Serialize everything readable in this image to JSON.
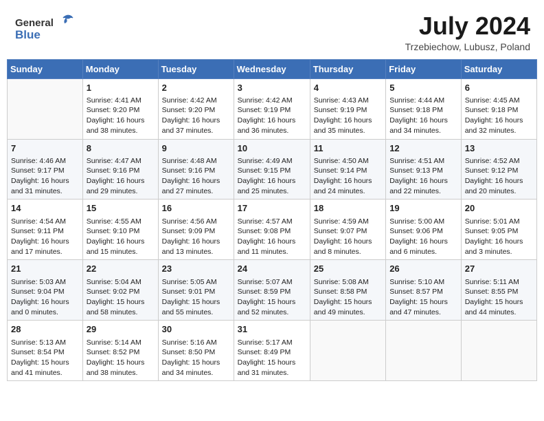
{
  "header": {
    "logo_general": "General",
    "logo_blue": "Blue",
    "month_year": "July 2024",
    "location": "Trzebiechow, Lubusz, Poland"
  },
  "weekdays": [
    "Sunday",
    "Monday",
    "Tuesday",
    "Wednesday",
    "Thursday",
    "Friday",
    "Saturday"
  ],
  "weeks": [
    [
      {
        "day": "",
        "sunrise": "",
        "sunset": "",
        "daylight": ""
      },
      {
        "day": "1",
        "sunrise": "Sunrise: 4:41 AM",
        "sunset": "Sunset: 9:20 PM",
        "daylight": "Daylight: 16 hours and 38 minutes."
      },
      {
        "day": "2",
        "sunrise": "Sunrise: 4:42 AM",
        "sunset": "Sunset: 9:20 PM",
        "daylight": "Daylight: 16 hours and 37 minutes."
      },
      {
        "day": "3",
        "sunrise": "Sunrise: 4:42 AM",
        "sunset": "Sunset: 9:19 PM",
        "daylight": "Daylight: 16 hours and 36 minutes."
      },
      {
        "day": "4",
        "sunrise": "Sunrise: 4:43 AM",
        "sunset": "Sunset: 9:19 PM",
        "daylight": "Daylight: 16 hours and 35 minutes."
      },
      {
        "day": "5",
        "sunrise": "Sunrise: 4:44 AM",
        "sunset": "Sunset: 9:18 PM",
        "daylight": "Daylight: 16 hours and 34 minutes."
      },
      {
        "day": "6",
        "sunrise": "Sunrise: 4:45 AM",
        "sunset": "Sunset: 9:18 PM",
        "daylight": "Daylight: 16 hours and 32 minutes."
      }
    ],
    [
      {
        "day": "7",
        "sunrise": "Sunrise: 4:46 AM",
        "sunset": "Sunset: 9:17 PM",
        "daylight": "Daylight: 16 hours and 31 minutes."
      },
      {
        "day": "8",
        "sunrise": "Sunrise: 4:47 AM",
        "sunset": "Sunset: 9:16 PM",
        "daylight": "Daylight: 16 hours and 29 minutes."
      },
      {
        "day": "9",
        "sunrise": "Sunrise: 4:48 AM",
        "sunset": "Sunset: 9:16 PM",
        "daylight": "Daylight: 16 hours and 27 minutes."
      },
      {
        "day": "10",
        "sunrise": "Sunrise: 4:49 AM",
        "sunset": "Sunset: 9:15 PM",
        "daylight": "Daylight: 16 hours and 25 minutes."
      },
      {
        "day": "11",
        "sunrise": "Sunrise: 4:50 AM",
        "sunset": "Sunset: 9:14 PM",
        "daylight": "Daylight: 16 hours and 24 minutes."
      },
      {
        "day": "12",
        "sunrise": "Sunrise: 4:51 AM",
        "sunset": "Sunset: 9:13 PM",
        "daylight": "Daylight: 16 hours and 22 minutes."
      },
      {
        "day": "13",
        "sunrise": "Sunrise: 4:52 AM",
        "sunset": "Sunset: 9:12 PM",
        "daylight": "Daylight: 16 hours and 20 minutes."
      }
    ],
    [
      {
        "day": "14",
        "sunrise": "Sunrise: 4:54 AM",
        "sunset": "Sunset: 9:11 PM",
        "daylight": "Daylight: 16 hours and 17 minutes."
      },
      {
        "day": "15",
        "sunrise": "Sunrise: 4:55 AM",
        "sunset": "Sunset: 9:10 PM",
        "daylight": "Daylight: 16 hours and 15 minutes."
      },
      {
        "day": "16",
        "sunrise": "Sunrise: 4:56 AM",
        "sunset": "Sunset: 9:09 PM",
        "daylight": "Daylight: 16 hours and 13 minutes."
      },
      {
        "day": "17",
        "sunrise": "Sunrise: 4:57 AM",
        "sunset": "Sunset: 9:08 PM",
        "daylight": "Daylight: 16 hours and 11 minutes."
      },
      {
        "day": "18",
        "sunrise": "Sunrise: 4:59 AM",
        "sunset": "Sunset: 9:07 PM",
        "daylight": "Daylight: 16 hours and 8 minutes."
      },
      {
        "day": "19",
        "sunrise": "Sunrise: 5:00 AM",
        "sunset": "Sunset: 9:06 PM",
        "daylight": "Daylight: 16 hours and 6 minutes."
      },
      {
        "day": "20",
        "sunrise": "Sunrise: 5:01 AM",
        "sunset": "Sunset: 9:05 PM",
        "daylight": "Daylight: 16 hours and 3 minutes."
      }
    ],
    [
      {
        "day": "21",
        "sunrise": "Sunrise: 5:03 AM",
        "sunset": "Sunset: 9:04 PM",
        "daylight": "Daylight: 16 hours and 0 minutes."
      },
      {
        "day": "22",
        "sunrise": "Sunrise: 5:04 AM",
        "sunset": "Sunset: 9:02 PM",
        "daylight": "Daylight: 15 hours and 58 minutes."
      },
      {
        "day": "23",
        "sunrise": "Sunrise: 5:05 AM",
        "sunset": "Sunset: 9:01 PM",
        "daylight": "Daylight: 15 hours and 55 minutes."
      },
      {
        "day": "24",
        "sunrise": "Sunrise: 5:07 AM",
        "sunset": "Sunset: 8:59 PM",
        "daylight": "Daylight: 15 hours and 52 minutes."
      },
      {
        "day": "25",
        "sunrise": "Sunrise: 5:08 AM",
        "sunset": "Sunset: 8:58 PM",
        "daylight": "Daylight: 15 hours and 49 minutes."
      },
      {
        "day": "26",
        "sunrise": "Sunrise: 5:10 AM",
        "sunset": "Sunset: 8:57 PM",
        "daylight": "Daylight: 15 hours and 47 minutes."
      },
      {
        "day": "27",
        "sunrise": "Sunrise: 5:11 AM",
        "sunset": "Sunset: 8:55 PM",
        "daylight": "Daylight: 15 hours and 44 minutes."
      }
    ],
    [
      {
        "day": "28",
        "sunrise": "Sunrise: 5:13 AM",
        "sunset": "Sunset: 8:54 PM",
        "daylight": "Daylight: 15 hours and 41 minutes."
      },
      {
        "day": "29",
        "sunrise": "Sunrise: 5:14 AM",
        "sunset": "Sunset: 8:52 PM",
        "daylight": "Daylight: 15 hours and 38 minutes."
      },
      {
        "day": "30",
        "sunrise": "Sunrise: 5:16 AM",
        "sunset": "Sunset: 8:50 PM",
        "daylight": "Daylight: 15 hours and 34 minutes."
      },
      {
        "day": "31",
        "sunrise": "Sunrise: 5:17 AM",
        "sunset": "Sunset: 8:49 PM",
        "daylight": "Daylight: 15 hours and 31 minutes."
      },
      {
        "day": "",
        "sunrise": "",
        "sunset": "",
        "daylight": ""
      },
      {
        "day": "",
        "sunrise": "",
        "sunset": "",
        "daylight": ""
      },
      {
        "day": "",
        "sunrise": "",
        "sunset": "",
        "daylight": ""
      }
    ]
  ]
}
